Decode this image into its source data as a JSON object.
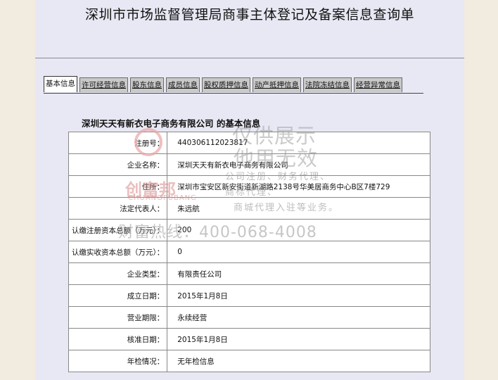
{
  "page": {
    "title": "深圳市市场监督管理局商事主体登记及备案信息查询单"
  },
  "tabs": [
    {
      "label": "基本信息"
    },
    {
      "label": "许可经营信息"
    },
    {
      "label": "股东信息"
    },
    {
      "label": "成员信息"
    },
    {
      "label": "股权质押信息"
    },
    {
      "label": "动产抵押信息"
    },
    {
      "label": "法院冻结信息"
    },
    {
      "label": "经营异常信息"
    }
  ],
  "section": {
    "heading": "深圳天天有新衣电子商务有限公司 的基本信息"
  },
  "info_rows": [
    {
      "label": "注册号：",
      "value": "440306112023817"
    },
    {
      "label": "企业名称：",
      "value": "深圳天天有新衣电子商务有限公司"
    },
    {
      "label": "住所：",
      "value": "深圳市宝安区新安街道新湖路2138号华美居商务中心B区7楼729"
    },
    {
      "label": "法定代表人：",
      "value": "朱远航"
    },
    {
      "label": "认缴注册资本总额（万元）：",
      "value": "200"
    },
    {
      "label": "认缴实收资本总额（万元）：",
      "value": "0"
    },
    {
      "label": "企业类型：",
      "value": "有限责任公司"
    },
    {
      "label": "成立日期：",
      "value": "2015年1月8日"
    },
    {
      "label": "营业期限：",
      "value": "永续经营"
    },
    {
      "label": "核准日期：",
      "value": "2015年1月8日"
    },
    {
      "label": "年检情况：",
      "value": "无年检信息"
    }
  ],
  "watermark": {
    "logo_text": "创富邦",
    "logo_sub": "CHUANGFUBANG",
    "line1": "仅供展示",
    "line2": "他用无效",
    "line3": "公司注册、财务代理、",
    "line4": "商标代理、",
    "line5": "商城代理入驻等业务。",
    "hotline": "财富热线：400-068-4008"
  }
}
